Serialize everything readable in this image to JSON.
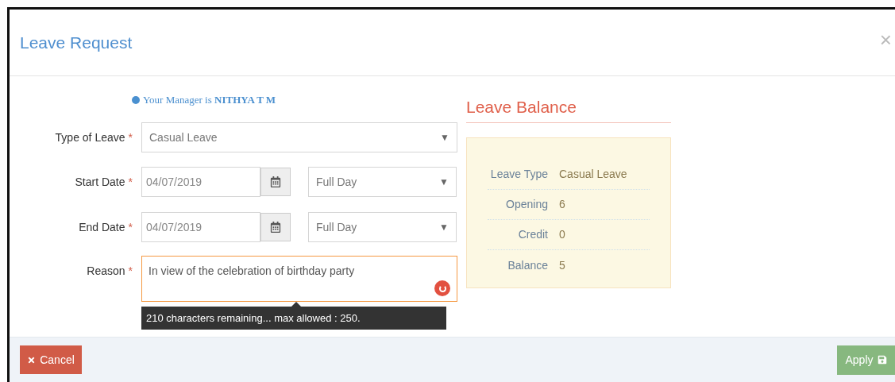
{
  "dialog": {
    "title": "Leave Request",
    "close": "×"
  },
  "manager_note": "Your Manager is **NITHYA T M**",
  "form": {
    "type_of_leave": {
      "label": "Type of Leave",
      "required": "*",
      "value": "Casual Leave",
      "arrow": "▼"
    },
    "start_date": {
      "label": "Start Date",
      "required": "*",
      "value": "04/07/2019",
      "session": "Full Day",
      "arrow": "▼"
    },
    "end_date": {
      "label": "End Date",
      "required": "*",
      "value": "04/07/2019",
      "session": "Full Day",
      "arrow": "▼"
    },
    "reason": {
      "label": "Reason",
      "required": "*",
      "value": "In view of the celebration of birthday party",
      "hint": "210 characters remaining... max allowed : 250."
    }
  },
  "leave_balance": {
    "title": "Leave Balance",
    "rows": [
      {
        "label": "Leave Type",
        "value": "Casual Leave"
      },
      {
        "label": "Opening",
        "value": "6"
      },
      {
        "label": "Credit",
        "value": "0"
      },
      {
        "label": "Balance",
        "value": "5"
      }
    ]
  },
  "footer": {
    "cancel": "Cancel",
    "apply": "Apply"
  }
}
